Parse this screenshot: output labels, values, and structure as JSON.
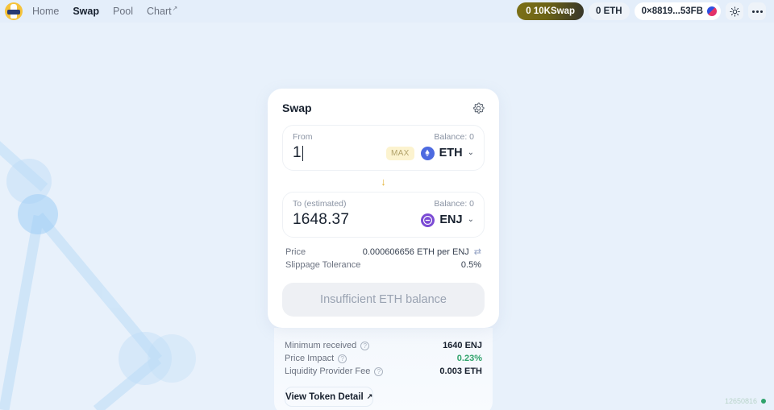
{
  "header": {
    "logo_icon": "10kswap-logo-icon",
    "nav": [
      {
        "label": "Home",
        "active": false,
        "external": false
      },
      {
        "label": "Swap",
        "active": true,
        "external": false
      },
      {
        "label": "Pool",
        "active": false,
        "external": false
      },
      {
        "label": "Chart",
        "active": false,
        "external": true
      }
    ],
    "external_marker": "↗",
    "swap_badge": "0 10KSwap",
    "eth_balance": "0 ETH",
    "wallet_address": "0×8819...53FB",
    "theme_icon": "sun-icon",
    "more_icon": "ellipsis-icon"
  },
  "swap": {
    "title": "Swap",
    "settings_icon": "gear-icon",
    "from": {
      "label": "From",
      "balance": "Balance: 0",
      "amount": "1",
      "max_label": "MAX",
      "token": "ETH",
      "token_icon": "ethereum-icon",
      "chevron": "⌄"
    },
    "switch_arrow": "↓",
    "to": {
      "label": "To (estimated)",
      "balance": "Balance: 0",
      "amount": "1648.37",
      "token": "ENJ",
      "token_icon": "enjin-icon",
      "chevron": "⌄"
    },
    "rates": [
      {
        "label": "Price",
        "value": "0.000606656 ETH per ENJ",
        "has_refresh": true
      },
      {
        "label": "Slippage Tolerance",
        "value": "0.5%",
        "has_refresh": false
      }
    ],
    "refresh_icon": "⇄",
    "action_button": "Insufficient ETH balance"
  },
  "details": {
    "rows": [
      {
        "label": "Minimum received",
        "value": "1640 ENJ",
        "positive": false
      },
      {
        "label": "Price Impact",
        "value": "0.23%",
        "positive": true
      },
      {
        "label": "Liquidity Provider Fee",
        "value": "0.003 ETH",
        "positive": false
      }
    ],
    "help_glyph": "?",
    "view_token_label": "View Token Detail",
    "view_token_ext": "↗"
  },
  "status": {
    "block_number": "12650816",
    "block_dot_color": "#2fa36b"
  },
  "colors": {
    "background": "#e8f1fb",
    "accent_yellow": "#e3b33c",
    "eth_blue": "#4d6ae0",
    "enj_purple": "#7b4bd4",
    "positive_green": "#2fa36b"
  }
}
